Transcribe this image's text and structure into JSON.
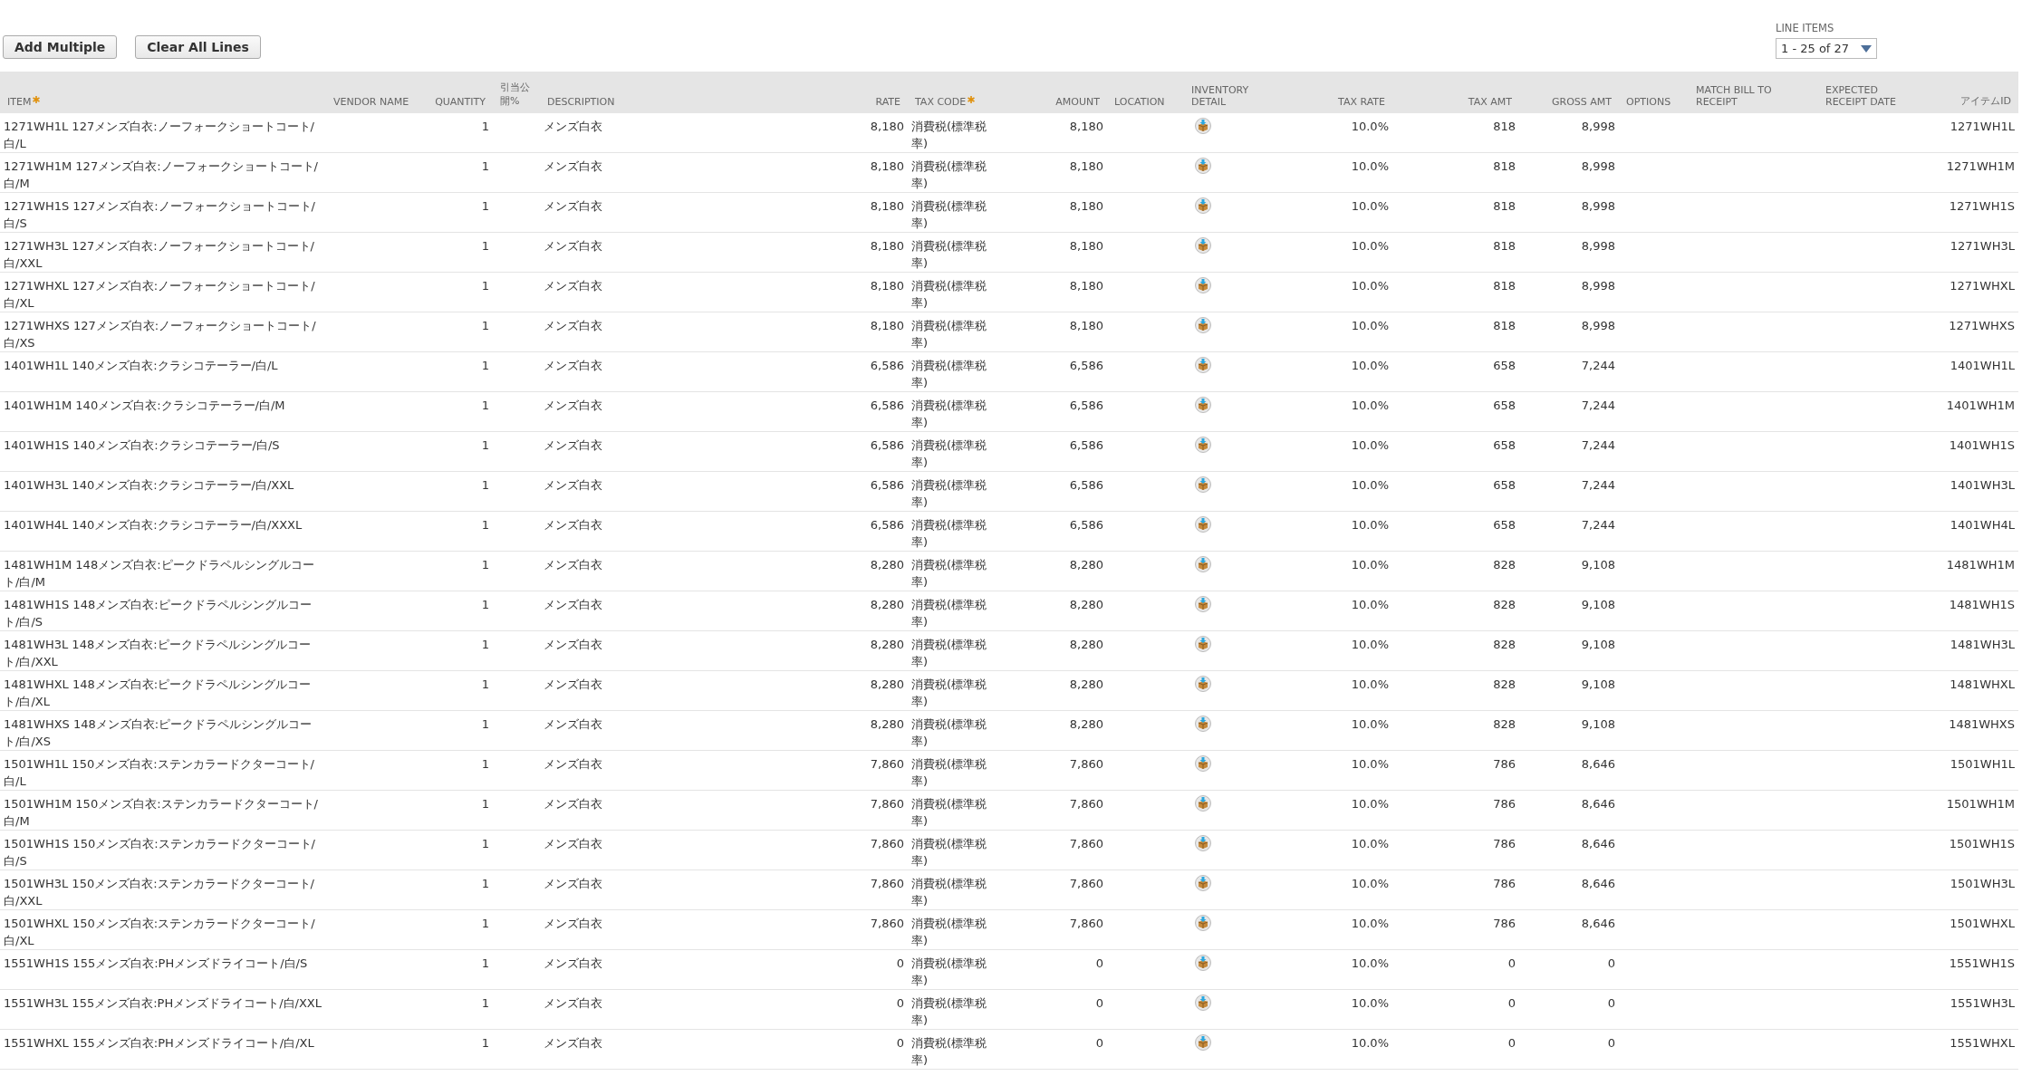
{
  "buttons": [
    "Add Multiple",
    "Clear All Lines"
  ],
  "line_items": {
    "label": "LINE ITEMS",
    "value": "1 - 25 of 27"
  },
  "columns": [
    {
      "label": "ITEM",
      "required": true
    },
    {
      "label": "VENDOR NAME",
      "required": false
    },
    {
      "label": "QUANTITY",
      "required": false
    },
    {
      "label": "引当公開%",
      "required": false
    },
    {
      "label": "DESCRIPTION",
      "required": false
    },
    {
      "label": "RATE",
      "required": false
    },
    {
      "label": "TAX CODE",
      "required": true
    },
    {
      "label": "AMOUNT",
      "required": false
    },
    {
      "label": "LOCATION",
      "required": false
    },
    {
      "label": "INVENTORY DETAIL",
      "required": false
    },
    {
      "label": "TAX RATE",
      "required": false
    },
    {
      "label": "TAX AMT",
      "required": false
    },
    {
      "label": "GROSS AMT",
      "required": false
    },
    {
      "label": "OPTIONS",
      "required": false
    },
    {
      "label": "MATCH BILL TO RECEIPT",
      "required": false
    },
    {
      "label": "EXPECTED RECEIPT DATE",
      "required": false
    },
    {
      "label": "アイテムID",
      "required": false
    }
  ],
  "rows": [
    {
      "item": "1271WH1L 127メンズ白衣:ノーフォークショートコート/白/L",
      "quantity": "1",
      "description": "メンズ白衣",
      "rate": "8,180",
      "tax_code": "消費税(標準税率)",
      "amount": "8,180",
      "tax_rate": "10.0%",
      "tax_amt": "818",
      "gross_amt": "8,998",
      "item_id": "1271WH1L"
    },
    {
      "item": "1271WH1M 127メンズ白衣:ノーフォークショートコート/白/M",
      "quantity": "1",
      "description": "メンズ白衣",
      "rate": "8,180",
      "tax_code": "消費税(標準税率)",
      "amount": "8,180",
      "tax_rate": "10.0%",
      "tax_amt": "818",
      "gross_amt": "8,998",
      "item_id": "1271WH1M"
    },
    {
      "item": "1271WH1S 127メンズ白衣:ノーフォークショートコート/白/S",
      "quantity": "1",
      "description": "メンズ白衣",
      "rate": "8,180",
      "tax_code": "消費税(標準税率)",
      "amount": "8,180",
      "tax_rate": "10.0%",
      "tax_amt": "818",
      "gross_amt": "8,998",
      "item_id": "1271WH1S"
    },
    {
      "item": "1271WH3L 127メンズ白衣:ノーフォークショートコート/白/XXL",
      "quantity": "1",
      "description": "メンズ白衣",
      "rate": "8,180",
      "tax_code": "消費税(標準税率)",
      "amount": "8,180",
      "tax_rate": "10.0%",
      "tax_amt": "818",
      "gross_amt": "8,998",
      "item_id": "1271WH3L"
    },
    {
      "item": "1271WHXL 127メンズ白衣:ノーフォークショートコート/白/XL",
      "quantity": "1",
      "description": "メンズ白衣",
      "rate": "8,180",
      "tax_code": "消費税(標準税率)",
      "amount": "8,180",
      "tax_rate": "10.0%",
      "tax_amt": "818",
      "gross_amt": "8,998",
      "item_id": "1271WHXL"
    },
    {
      "item": "1271WHXS 127メンズ白衣:ノーフォークショートコート/白/XS",
      "quantity": "1",
      "description": "メンズ白衣",
      "rate": "8,180",
      "tax_code": "消費税(標準税率)",
      "amount": "8,180",
      "tax_rate": "10.0%",
      "tax_amt": "818",
      "gross_amt": "8,998",
      "item_id": "1271WHXS"
    },
    {
      "item": "1401WH1L 140メンズ白衣:クラシコテーラー/白/L",
      "quantity": "1",
      "description": "メンズ白衣",
      "rate": "6,586",
      "tax_code": "消費税(標準税率)",
      "amount": "6,586",
      "tax_rate": "10.0%",
      "tax_amt": "658",
      "gross_amt": "7,244",
      "item_id": "1401WH1L"
    },
    {
      "item": "1401WH1M 140メンズ白衣:クラシコテーラー/白/M",
      "quantity": "1",
      "description": "メンズ白衣",
      "rate": "6,586",
      "tax_code": "消費税(標準税率)",
      "amount": "6,586",
      "tax_rate": "10.0%",
      "tax_amt": "658",
      "gross_amt": "7,244",
      "item_id": "1401WH1M"
    },
    {
      "item": "1401WH1S 140メンズ白衣:クラシコテーラー/白/S",
      "quantity": "1",
      "description": "メンズ白衣",
      "rate": "6,586",
      "tax_code": "消費税(標準税率)",
      "amount": "6,586",
      "tax_rate": "10.0%",
      "tax_amt": "658",
      "gross_amt": "7,244",
      "item_id": "1401WH1S"
    },
    {
      "item": "1401WH3L 140メンズ白衣:クラシコテーラー/白/XXL",
      "quantity": "1",
      "description": "メンズ白衣",
      "rate": "6,586",
      "tax_code": "消費税(標準税率)",
      "amount": "6,586",
      "tax_rate": "10.0%",
      "tax_amt": "658",
      "gross_amt": "7,244",
      "item_id": "1401WH3L"
    },
    {
      "item": "1401WH4L 140メンズ白衣:クラシコテーラー/白/XXXL",
      "quantity": "1",
      "description": "メンズ白衣",
      "rate": "6,586",
      "tax_code": "消費税(標準税率)",
      "amount": "6,586",
      "tax_rate": "10.0%",
      "tax_amt": "658",
      "gross_amt": "7,244",
      "item_id": "1401WH4L"
    },
    {
      "item": "1481WH1M 148メンズ白衣:ピークドラペルシングルコート/白/M",
      "quantity": "1",
      "description": "メンズ白衣",
      "rate": "8,280",
      "tax_code": "消費税(標準税率)",
      "amount": "8,280",
      "tax_rate": "10.0%",
      "tax_amt": "828",
      "gross_amt": "9,108",
      "item_id": "1481WH1M"
    },
    {
      "item": "1481WH1S 148メンズ白衣:ピークドラペルシングルコート/白/S",
      "quantity": "1",
      "description": "メンズ白衣",
      "rate": "8,280",
      "tax_code": "消費税(標準税率)",
      "amount": "8,280",
      "tax_rate": "10.0%",
      "tax_amt": "828",
      "gross_amt": "9,108",
      "item_id": "1481WH1S"
    },
    {
      "item": "1481WH3L 148メンズ白衣:ピークドラペルシングルコート/白/XXL",
      "quantity": "1",
      "description": "メンズ白衣",
      "rate": "8,280",
      "tax_code": "消費税(標準税率)",
      "amount": "8,280",
      "tax_rate": "10.0%",
      "tax_amt": "828",
      "gross_amt": "9,108",
      "item_id": "1481WH3L"
    },
    {
      "item": "1481WHXL 148メンズ白衣:ピークドラペルシングルコート/白/XL",
      "quantity": "1",
      "description": "メンズ白衣",
      "rate": "8,280",
      "tax_code": "消費税(標準税率)",
      "amount": "8,280",
      "tax_rate": "10.0%",
      "tax_amt": "828",
      "gross_amt": "9,108",
      "item_id": "1481WHXL"
    },
    {
      "item": "1481WHXS 148メンズ白衣:ピークドラペルシングルコート/白/XS",
      "quantity": "1",
      "description": "メンズ白衣",
      "rate": "8,280",
      "tax_code": "消費税(標準税率)",
      "amount": "8,280",
      "tax_rate": "10.0%",
      "tax_amt": "828",
      "gross_amt": "9,108",
      "item_id": "1481WHXS"
    },
    {
      "item": "1501WH1L 150メンズ白衣:ステンカラードクターコート/白/L",
      "quantity": "1",
      "description": "メンズ白衣",
      "rate": "7,860",
      "tax_code": "消費税(標準税率)",
      "amount": "7,860",
      "tax_rate": "10.0%",
      "tax_amt": "786",
      "gross_amt": "8,646",
      "item_id": "1501WH1L"
    },
    {
      "item": "1501WH1M 150メンズ白衣:ステンカラードクターコート/白/M",
      "quantity": "1",
      "description": "メンズ白衣",
      "rate": "7,860",
      "tax_code": "消費税(標準税率)",
      "amount": "7,860",
      "tax_rate": "10.0%",
      "tax_amt": "786",
      "gross_amt": "8,646",
      "item_id": "1501WH1M"
    },
    {
      "item": "1501WH1S 150メンズ白衣:ステンカラードクターコート/白/S",
      "quantity": "1",
      "description": "メンズ白衣",
      "rate": "7,860",
      "tax_code": "消費税(標準税率)",
      "amount": "7,860",
      "tax_rate": "10.0%",
      "tax_amt": "786",
      "gross_amt": "8,646",
      "item_id": "1501WH1S"
    },
    {
      "item": "1501WH3L 150メンズ白衣:ステンカラードクターコート/白/XXL",
      "quantity": "1",
      "description": "メンズ白衣",
      "rate": "7,860",
      "tax_code": "消費税(標準税率)",
      "amount": "7,860",
      "tax_rate": "10.0%",
      "tax_amt": "786",
      "gross_amt": "8,646",
      "item_id": "1501WH3L"
    },
    {
      "item": "1501WHXL 150メンズ白衣:ステンカラードクターコート/白/XL",
      "quantity": "1",
      "description": "メンズ白衣",
      "rate": "7,860",
      "tax_code": "消費税(標準税率)",
      "amount": "7,860",
      "tax_rate": "10.0%",
      "tax_amt": "786",
      "gross_amt": "8,646",
      "item_id": "1501WHXL"
    },
    {
      "item": "1551WH1S 155メンズ白衣:PHメンズドライコート/白/S",
      "quantity": "1",
      "description": "メンズ白衣",
      "rate": "0",
      "tax_code": "消費税(標準税率)",
      "amount": "0",
      "tax_rate": "10.0%",
      "tax_amt": "0",
      "gross_amt": "0",
      "item_id": "1551WH1S"
    },
    {
      "item": "1551WH3L 155メンズ白衣:PHメンズドライコート/白/XXL",
      "quantity": "1",
      "description": "メンズ白衣",
      "rate": "0",
      "tax_code": "消費税(標準税率)",
      "amount": "0",
      "tax_rate": "10.0%",
      "tax_amt": "0",
      "gross_amt": "0",
      "item_id": "1551WH3L"
    },
    {
      "item": "1551WHXL 155メンズ白衣:PHメンズドライコート/白/XL",
      "quantity": "1",
      "description": "メンズ白衣",
      "rate": "0",
      "tax_code": "消費税(標準税率)",
      "amount": "0",
      "tax_rate": "10.0%",
      "tax_amt": "0",
      "gross_amt": "0",
      "item_id": "1551WHXL"
    }
  ]
}
